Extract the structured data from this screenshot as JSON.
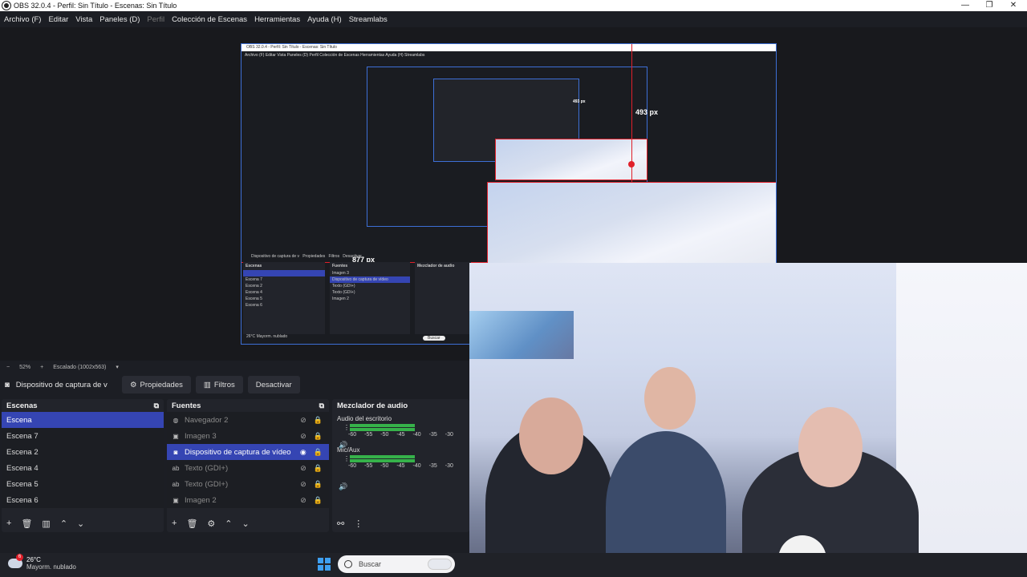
{
  "window": {
    "title": "OBS 32.0.4 - Perfil: Sin Título - Escenas: Sin Título",
    "controls": [
      "—",
      "❐",
      "✕"
    ]
  },
  "menu": [
    {
      "label": "Archivo (F)",
      "enabled": true
    },
    {
      "label": "Editar",
      "enabled": true
    },
    {
      "label": "Vista",
      "enabled": true
    },
    {
      "label": "Paneles (D)",
      "enabled": true
    },
    {
      "label": "Perfil",
      "enabled": false
    },
    {
      "label": "Colección de Escenas",
      "enabled": true
    },
    {
      "label": "Herramientas",
      "enabled": true
    },
    {
      "label": "Ayuda (H)",
      "enabled": true
    },
    {
      "label": "Streamlabs",
      "enabled": true
    }
  ],
  "preview": {
    "measure_vertical": "493 px",
    "measure_horizontal": "877 px",
    "inner_measure": "493 px"
  },
  "zoom": {
    "minus": "−",
    "value": "52%",
    "plus": "+",
    "scaling": "Escalado (1002x563)"
  },
  "source_toolbar": {
    "source_name": "Dispositivo de captura de v",
    "properties": "Propiedades",
    "filters": "Filtros",
    "deactivate": "Desactivar"
  },
  "scenes": {
    "title": "Escenas",
    "items": [
      "Escena",
      "Escena 7",
      "Escena 2",
      "Escena 4",
      "Escena 5",
      "Escena 6"
    ],
    "selected_index": 0
  },
  "sources": {
    "title": "Fuentes",
    "items": [
      {
        "label": "Navegador 2",
        "icon": "globe-icon",
        "glyph": "◍",
        "dim": true
      },
      {
        "label": "Imagen 3",
        "icon": "image-icon",
        "glyph": "▣",
        "dim": true
      },
      {
        "label": "Dispositivo de captura de vídeo",
        "icon": "camera-icon",
        "glyph": "◙",
        "selected": true
      },
      {
        "label": "Texto (GDI+)",
        "icon": "text-icon",
        "glyph": "ab",
        "dim": true
      },
      {
        "label": "Texto (GDI+)",
        "icon": "text-icon",
        "glyph": "ab",
        "dim": true
      },
      {
        "label": "Imagen 2",
        "icon": "image-icon",
        "glyph": "▣",
        "dim": true
      }
    ]
  },
  "mixer": {
    "title": "Mezclador de audio",
    "channels": [
      {
        "name": "Audio del escritorio",
        "level": 0.58,
        "ticks": [
          "-60",
          "-55",
          "-50",
          "-45",
          "-40",
          "-35",
          "-30"
        ]
      },
      {
        "name": "Mic/Aux",
        "level": 0.58,
        "ticks": [
          "-60",
          "-55",
          "-50",
          "-45",
          "-40",
          "-35",
          "-30"
        ]
      }
    ]
  },
  "taskbar": {
    "weather_temp": "26°C",
    "weather_desc": "Mayorm. nublado",
    "notif_count": "6",
    "search_placeholder": "Buscar"
  },
  "embedded_preview": {
    "title": "OBS 32.0.4 - Perfil: Sin Título - Escenas: Sin Título",
    "menu": "Archivo (F)  Editar  Vista  Paneles (D)  Perfil  Colección de Escenas  Herramientas  Ayuda (H)  Streamlabs",
    "source": "Dispositivo de captura de v",
    "props": "Propiedades",
    "filters": "Filtros",
    "deact": "Desactivar",
    "scenes_h": "Escenas",
    "sources_h": "Fuentes",
    "mixer_h": "Mezclador de audio",
    "scenes": [
      "Escena 7",
      "Escena 2",
      "Escena 4",
      "Escena 5",
      "Escena 6"
    ],
    "sources": [
      "Imagen 3",
      "Dispositivo de captura de vídeo",
      "Texto (GDI+)",
      "Texto (GDI+)",
      "Imagen 2"
    ],
    "weather": "26°C",
    "weather_desc": "Mayorm. nublado",
    "search": "Buscar"
  }
}
